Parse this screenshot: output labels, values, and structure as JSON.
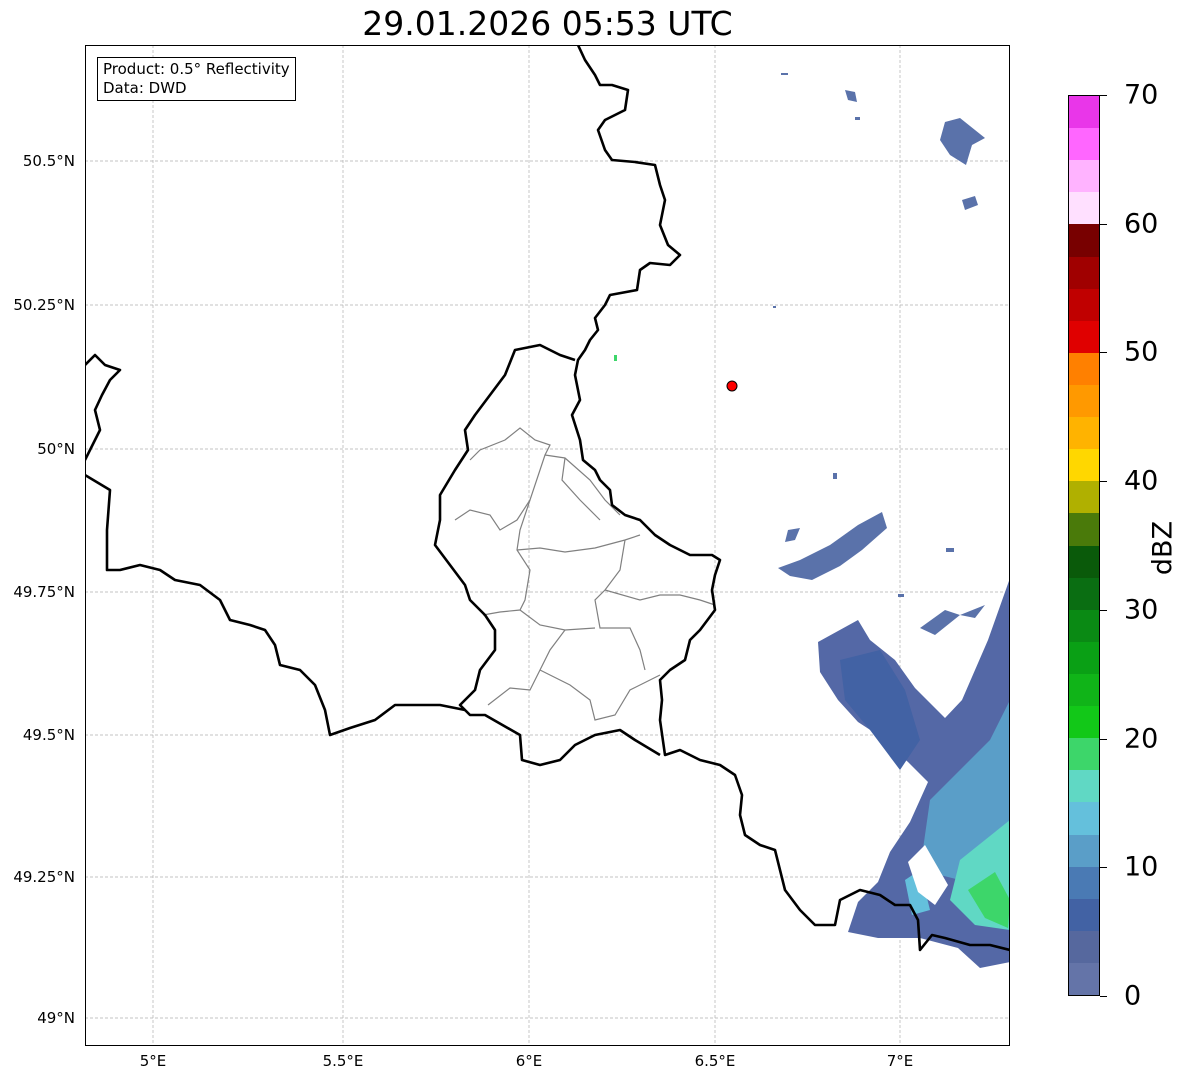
{
  "title": "29.01.2026 05:53 UTC",
  "info_box": {
    "line1": "Product: 0.5° Reflectivity",
    "line2": "Data: DWD"
  },
  "lat_labels": [
    "50.5°N",
    "50.25°N",
    "50°N",
    "49.75°N",
    "49.5°N",
    "49.25°N",
    "49°N"
  ],
  "lon_labels": [
    "5°E",
    "5.5°E",
    "6°E",
    "6.5°E",
    "7°E"
  ],
  "colorbar": {
    "label": "dBZ",
    "ticks": [
      "0",
      "10",
      "20",
      "30",
      "40",
      "50",
      "60",
      "70"
    ],
    "range": [
      0,
      70
    ],
    "step": 2.5,
    "colors_top_to_bottom": [
      "#e936e9",
      "#ff66ff",
      "#ffb3ff",
      "#ffe0ff",
      "#780000",
      "#a00000",
      "#c00000",
      "#e00000",
      "#ff8000",
      "#ff9900",
      "#ffb300",
      "#ffd700",
      "#b0b000",
      "#4a7a0a",
      "#0a5a0a",
      "#0a6e12",
      "#0a8a14",
      "#0aa015",
      "#10b418",
      "#12c818",
      "#3dd66a",
      "#60d8c4",
      "#64c0dc",
      "#5a9ec8",
      "#4a7ab4",
      "#4262a4",
      "#56689e",
      "#6474a8"
    ]
  },
  "marker": {
    "color": "#ff0000",
    "type": "radar-site"
  },
  "map_extent": {
    "lon": [
      4.82,
      7.3
    ],
    "lat": [
      48.95,
      50.7
    ]
  }
}
